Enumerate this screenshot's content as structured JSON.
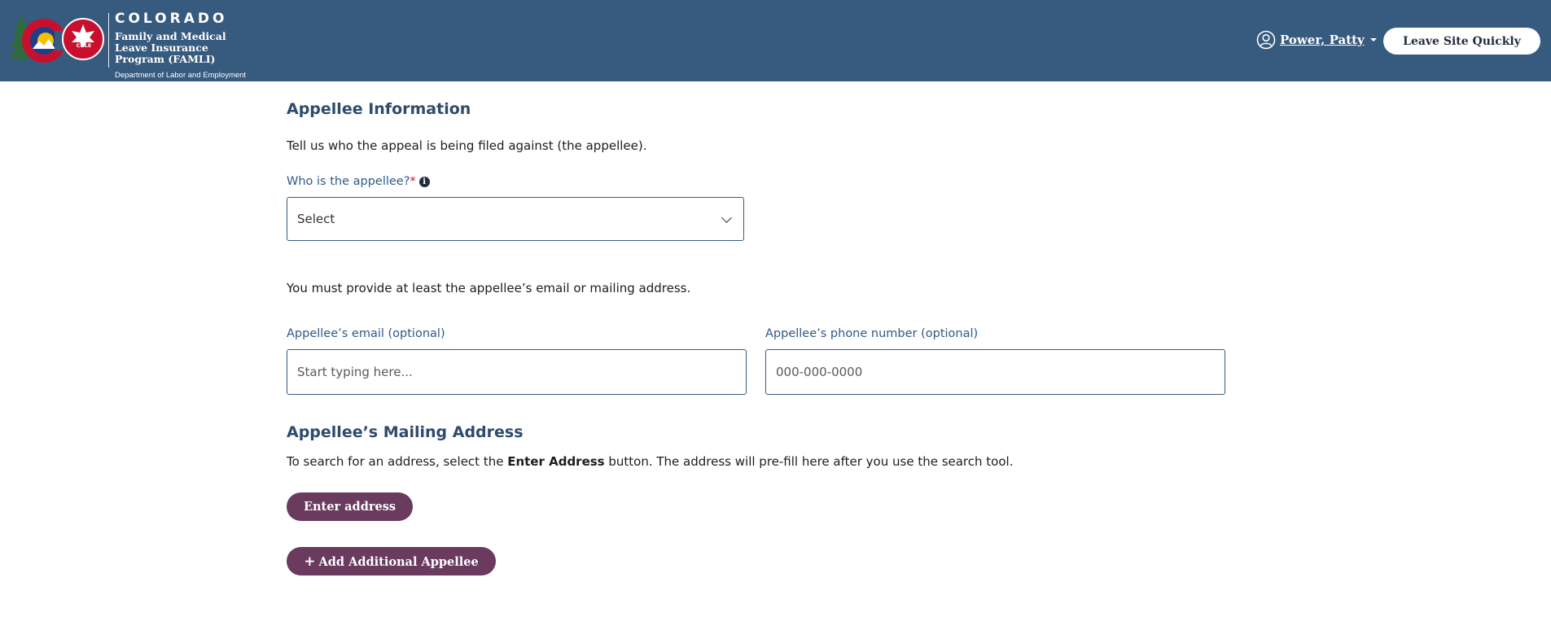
{
  "header": {
    "brand_title": "COLORADO",
    "program_name": "Family and Medical Leave Insurance Program (FAMLI)",
    "department": "Department of Labor and Employment",
    "cdle_badge": "CDLE",
    "user_name": "Power, Patty",
    "leave_button": "Leave Site Quickly"
  },
  "appellee_info": {
    "heading": "Appellee Information",
    "intro": "Tell us who the appeal is being filed against (the appellee).",
    "appellee_label": "Who is the appellee?",
    "required_marker": "*",
    "info_glyph": "i",
    "select_value": "Select",
    "contact_note": "You must provide at least the appellee’s email or mailing address.",
    "email_label": "Appellee’s email (optional)",
    "email_placeholder": "Start typing here...",
    "phone_label": "Appellee’s phone number (optional)",
    "phone_placeholder": "000-000-0000"
  },
  "mailing_address": {
    "heading": "Appellee’s Mailing Address",
    "instruction_pre": "To search for an address, select the ",
    "instruction_bold": "Enter Address",
    "instruction_post": " button. The address will pre-fill here after you use the search tool.",
    "enter_button": "Enter address"
  },
  "add_appellee": {
    "plus_glyph": "+",
    "label": "Add Additional Appellee"
  },
  "icons": [
    "user-circle-icon",
    "caret-down-icon",
    "info-icon",
    "chevron-down-icon",
    "plus-icon",
    "colorado-logo-icon",
    "cdle-logo-icon"
  ],
  "colors": {
    "header_bg": "#375a7f",
    "button_bg": "#6a3a5f",
    "heading": "#2e4a6d",
    "required": "#c8102e"
  }
}
